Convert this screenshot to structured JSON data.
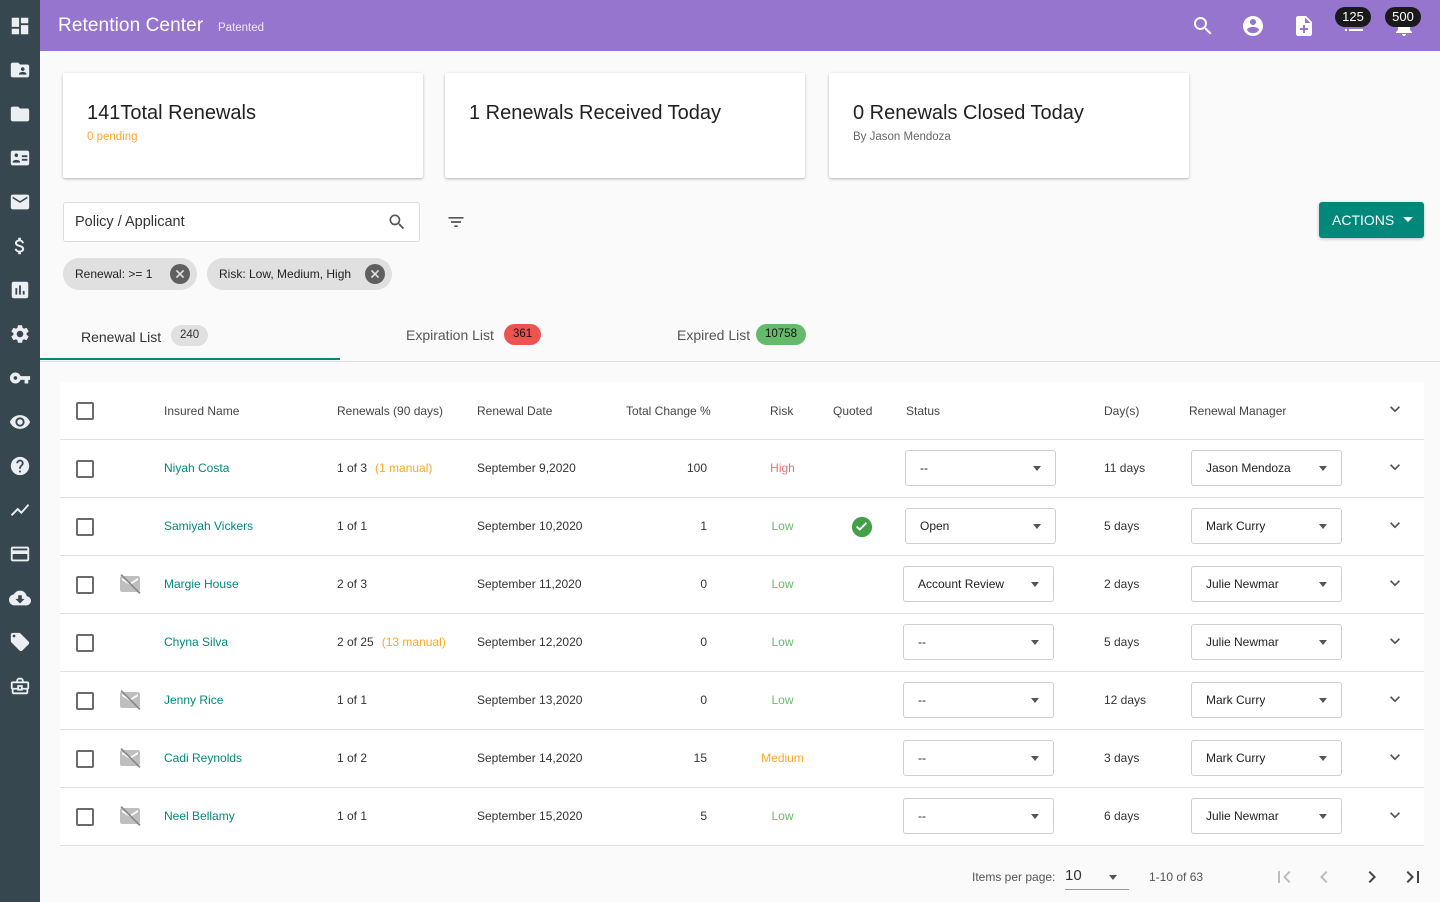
{
  "app": {
    "title": "Retention Center",
    "subtitle": "Patented"
  },
  "sidebar": {
    "icons": [
      "dashboard-icon",
      "account-folder-icon",
      "folder-icon",
      "contact-card-icon",
      "mail-icon",
      "dollar-icon",
      "bar-chart-icon",
      "settings-icon",
      "key-icon",
      "eye-icon",
      "help-icon",
      "trending-icon",
      "credit-card-icon",
      "cloud-download-icon",
      "tags-icon",
      "briefcase-icon"
    ]
  },
  "topbar": {
    "icons": [
      "search-icon",
      "account-circle-icon",
      "note-add-icon",
      "list-icon",
      "notifications-icon"
    ],
    "badges": {
      "list": "125",
      "notifications": "500"
    }
  },
  "cards": [
    {
      "title": "141Total Renewals",
      "subtitle": "0 pending",
      "subtitle_color": "#f9a825"
    },
    {
      "title": "1 Renewals Received Today",
      "subtitle": ""
    },
    {
      "title": "0 Renewals Closed Today",
      "subtitle": "By Jason Mendoza",
      "subtitle_color": "#666666"
    }
  ],
  "search": {
    "placeholder": "Policy / Applicant"
  },
  "actions_label": "ACTIONS",
  "filters": [
    {
      "label": "Renewal: >= 1"
    },
    {
      "label": "Risk: Low, Medium, High"
    }
  ],
  "tabs": [
    {
      "label": "Renewal List",
      "count": "240",
      "count_color": "#e0e0e0",
      "active": true
    },
    {
      "label": "Expiration List",
      "count": "361",
      "count_color": "#ef5350"
    },
    {
      "label": "Expired List",
      "count": "10758",
      "count_color": "#66bb6a"
    }
  ],
  "table": {
    "headers": {
      "name": "Insured Name",
      "renewals": "Renewals (90 days)",
      "date": "Renewal Date",
      "change": "Total Change %",
      "risk": "Risk",
      "quoted": "Quoted",
      "status": "Status",
      "days": "Day(s)",
      "manager": "Renewal Manager"
    },
    "rows": [
      {
        "name": "Niyah Costa",
        "renewals": "1 of 3",
        "manual": "(1 manual)",
        "date": "September 9,2020",
        "change": "100",
        "risk": "High",
        "quoted": false,
        "no_mail": false,
        "status": "--",
        "days": "11 days",
        "manager": "Jason Mendoza"
      },
      {
        "name": "Samiyah Vickers",
        "renewals": "1 of 1",
        "manual": "",
        "date": "September 10,2020",
        "change": "1",
        "risk": "Low",
        "quoted": true,
        "no_mail": false,
        "status": "Open",
        "days": "5 days",
        "manager": "Mark Curry"
      },
      {
        "name": "Margie House",
        "renewals": "2 of 3",
        "manual": "",
        "date": "September 11,2020",
        "change": "0",
        "risk": "Low",
        "quoted": false,
        "no_mail": true,
        "status": "Account Review",
        "days": "2 days",
        "manager": "Julie Newmar"
      },
      {
        "name": "Chyna Silva",
        "renewals": "2 of 25",
        "manual": "(13 manual)",
        "date": "September 12,2020",
        "change": "0",
        "risk": "Low",
        "quoted": false,
        "no_mail": false,
        "status": "--",
        "days": "5 days",
        "manager": "Julie Newmar"
      },
      {
        "name": "Jenny Rice",
        "renewals": "1 of 1",
        "manual": "",
        "date": "September 13,2020",
        "change": "0",
        "risk": "Low",
        "quoted": false,
        "no_mail": true,
        "status": "--",
        "days": "12 days",
        "manager": "Mark Curry"
      },
      {
        "name": "Cadi Reynolds",
        "renewals": "1 of 2",
        "manual": "",
        "date": "September 14,2020",
        "change": "15",
        "risk": "Medium",
        "quoted": false,
        "no_mail": true,
        "status": "--",
        "days": "3 days",
        "manager": "Mark Curry"
      },
      {
        "name": "Neel Bellamy",
        "renewals": "1 of 1",
        "manual": "",
        "date": "September 15,2020",
        "change": "5",
        "risk": "Low",
        "quoted": false,
        "no_mail": true,
        "status": "--",
        "days": "6 days",
        "manager": "Julie Newmar"
      }
    ]
  },
  "pagination": {
    "items_per_page_label": "Items per page:",
    "items_per_page": "10",
    "range": "1-10 of 63"
  },
  "colors": {
    "topbar": "#9575cd",
    "sidebar": "#37474f",
    "accent": "#00897b"
  }
}
